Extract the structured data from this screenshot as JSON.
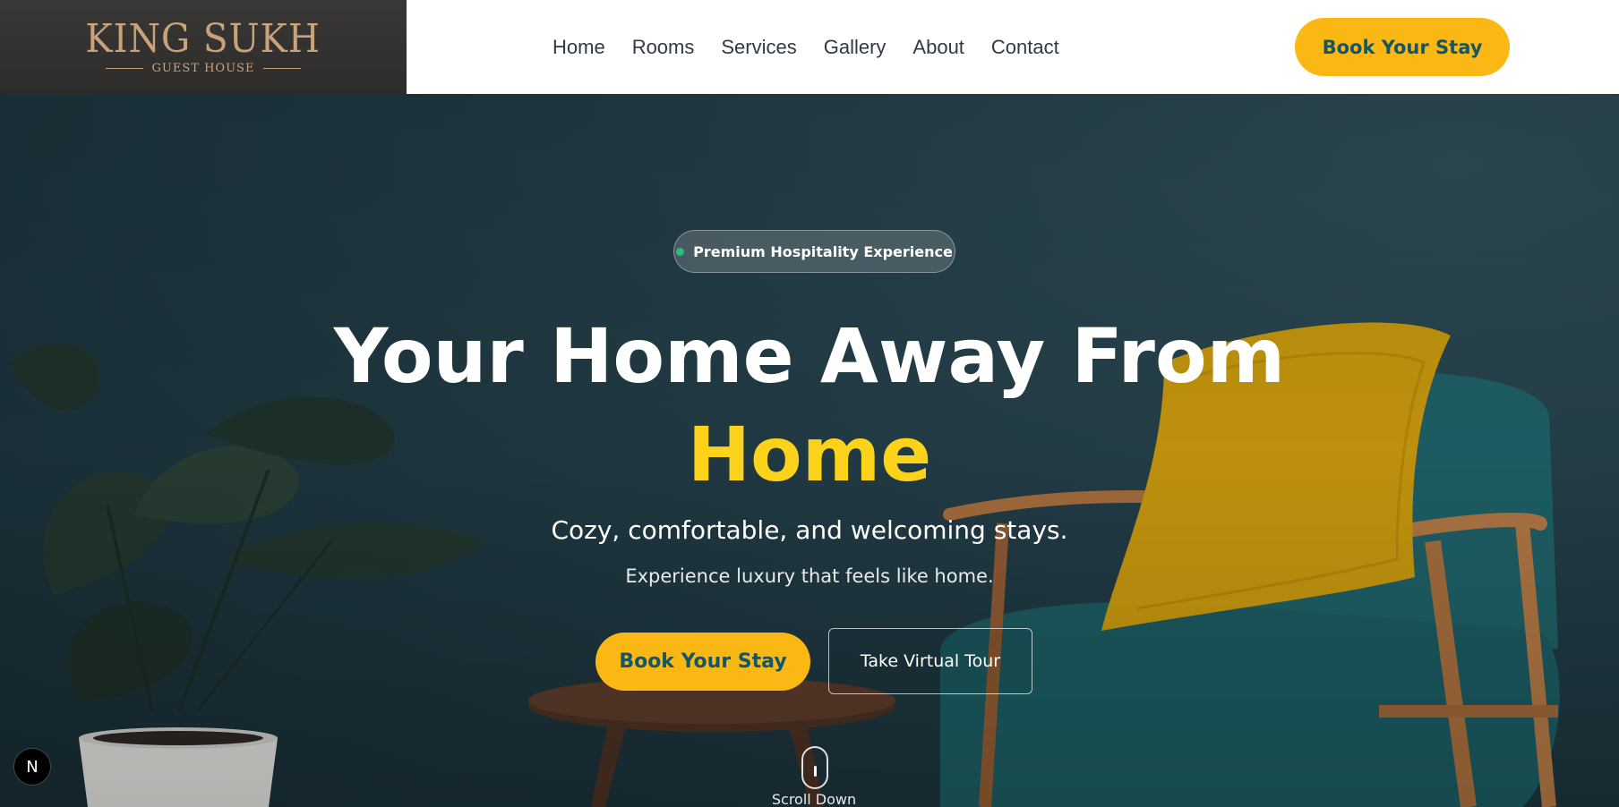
{
  "header": {
    "logo_title": "KING SUKH",
    "logo_subtitle": "GUEST HOUSE",
    "nav": [
      "Home",
      "Rooms",
      "Services",
      "Gallery",
      "About",
      "Contact"
    ],
    "cta_label": "Book Your Stay"
  },
  "hero": {
    "badge_text": "Premium Hospitality Experience",
    "headline": "Your Home Away From",
    "headline_accent": "Home",
    "subhead": "Cozy, comfortable, and welcoming stays.",
    "subtext": "Experience luxury that feels like home.",
    "primary_button": "Book Your Stay",
    "secondary_button": "Take Virtual Tour",
    "scroll_label": "Scroll Down"
  },
  "dev_badge": {
    "letter": "N"
  },
  "colors": {
    "accent_yellow": "#fbb713",
    "accent_text_teal": "#145566",
    "headline_yellow": "#fcd21a",
    "badge_dot_green": "#22c07a",
    "logo_gold": "#c9a27a"
  },
  "icons": {
    "scroll": "mouse-scroll-icon",
    "dev": "nextjs-n-icon"
  }
}
